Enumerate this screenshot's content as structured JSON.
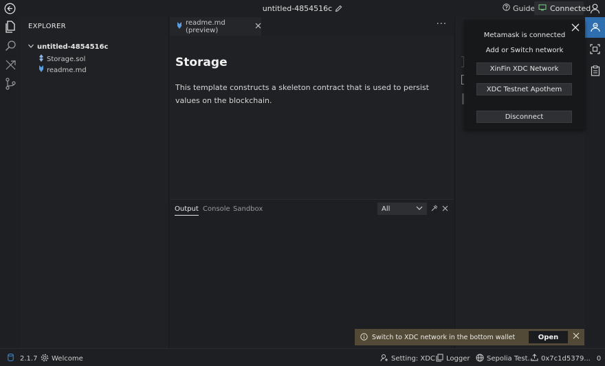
{
  "titlebar": {
    "title": "untitled-4854516c",
    "guide_label": "Guide",
    "connected_label": "Connected"
  },
  "explorer": {
    "title": "EXPLORER",
    "workspace": "untitled-4854516c",
    "files": [
      "Storage.sol",
      "readme.md"
    ]
  },
  "editor": {
    "tab_label": "readme.md (preview)",
    "heading": "Storage",
    "paragraph": "This template constructs a skeleton contract that is used to persist values on the blockchain."
  },
  "panel": {
    "tabs": [
      "Output",
      "Console",
      "Sandbox"
    ],
    "filter_value": "All"
  },
  "popup": {
    "status": "Metamask is connected",
    "prompt": "Add or Switch network",
    "buttons": [
      "XinFin XDC Network",
      "XDC Testnet Apothem",
      "Disconnect"
    ]
  },
  "notification": {
    "message": "Switch to XDC network in the bottom wallet",
    "action": "Open"
  },
  "statusbar": {
    "version": "2.1.7",
    "welcome": "Welcome",
    "setting": "Setting: XDC",
    "logger": "Logger",
    "network": "Sepolia Test...",
    "account": "0x7c1d5379...",
    "balance": "0"
  },
  "colors": {
    "accent": "#2f6fb0",
    "notification_bg": "#524a36",
    "background": "#1e1f22"
  }
}
